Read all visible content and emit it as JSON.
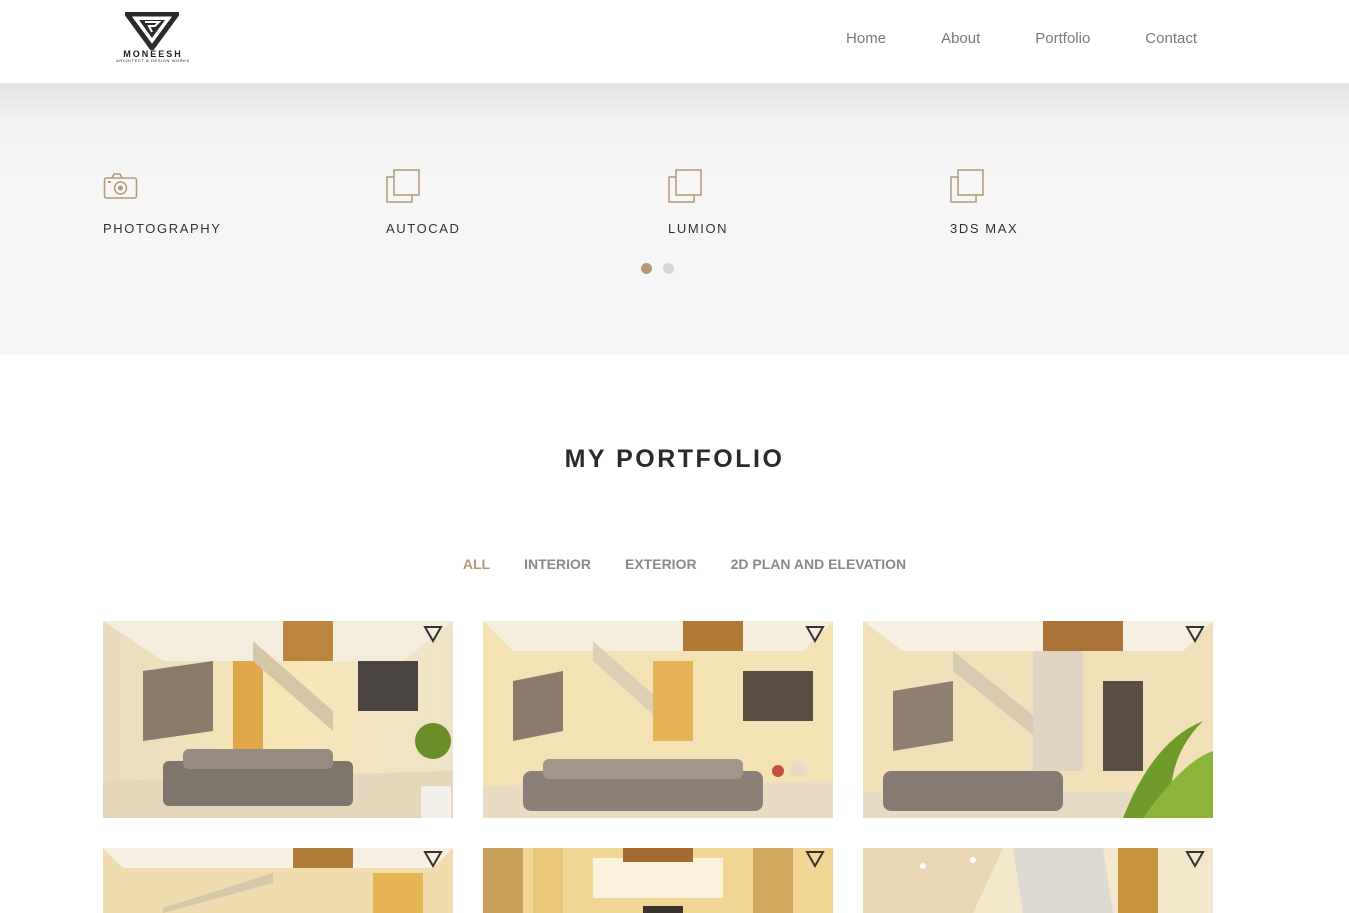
{
  "header": {
    "logo": {
      "name": "MONEESH",
      "tagline": "ARCHITECT & DESIGN WORKS"
    },
    "nav": [
      "Home",
      "About",
      "Portfolio",
      "Contact"
    ]
  },
  "skills": {
    "items": [
      {
        "label": "PHOTOGRAPHY",
        "icon": "camera-icon"
      },
      {
        "label": "AUTOCAD",
        "icon": "copy-icon"
      },
      {
        "label": "LUMION",
        "icon": "copy-icon"
      },
      {
        "label": "3DS MAX",
        "icon": "copy-icon"
      }
    ],
    "carousel": {
      "pages": 2,
      "active": 1
    }
  },
  "portfolio": {
    "title": "MY PORTFOLIO",
    "filters": [
      {
        "label": "ALL",
        "active": true
      },
      {
        "label": "INTERIOR",
        "active": false
      },
      {
        "label": "EXTERIOR",
        "active": false
      },
      {
        "label": "2D PLAN AND ELEVATION",
        "active": false
      }
    ],
    "items": [
      {
        "subject": "living room interior render",
        "icon": "logo-watermark-icon"
      },
      {
        "subject": "living room interior render",
        "icon": "logo-watermark-icon"
      },
      {
        "subject": "living room interior render",
        "icon": "logo-watermark-icon"
      },
      {
        "subject": "staircase interior render",
        "icon": "logo-watermark-icon"
      },
      {
        "subject": "bedroom interior render",
        "icon": "logo-watermark-icon"
      },
      {
        "subject": "wall detail interior render",
        "icon": "logo-watermark-icon"
      }
    ]
  },
  "colors": {
    "accent": "#b39a74",
    "nav_text": "#7a7a7a",
    "band": "#f6f6f6"
  }
}
